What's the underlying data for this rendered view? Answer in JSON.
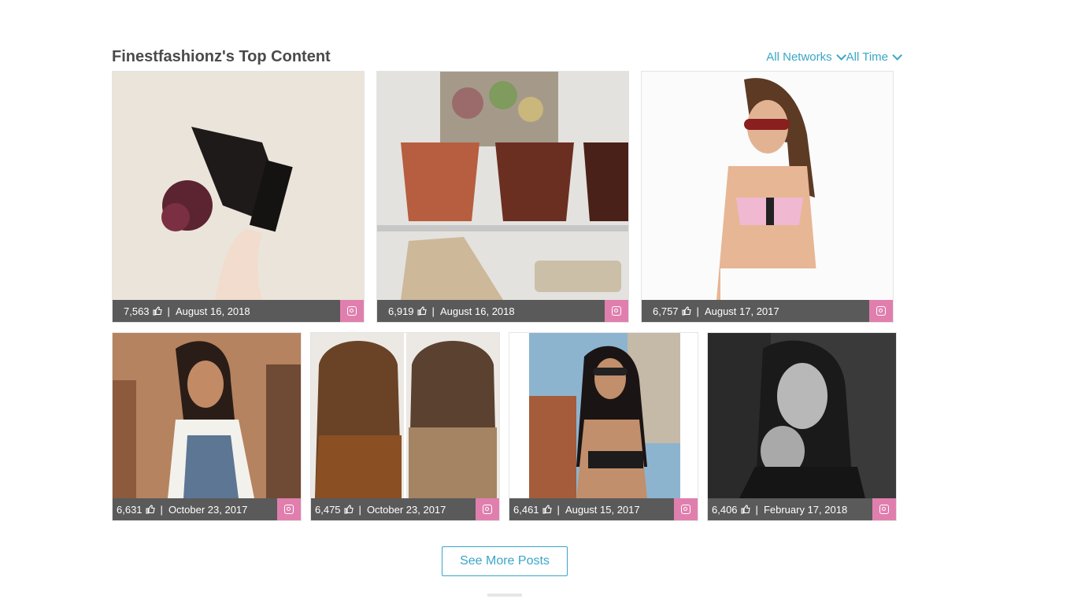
{
  "header": {
    "title": "Finestfashionz's Top Content",
    "filter_network": "All Networks",
    "filter_time": "All Time"
  },
  "posts": [
    {
      "likes": "7,563",
      "date": "August 16, 2018",
      "network_icon": "instagram-icon"
    },
    {
      "likes": "6,919",
      "date": "August 16, 2018",
      "network_icon": "instagram-icon"
    },
    {
      "likes": "6,757",
      "date": "August 17, 2017",
      "network_icon": "instagram-icon"
    },
    {
      "likes": "6,631",
      "date": "October 23, 2017",
      "network_icon": "instagram-icon"
    },
    {
      "likes": "6,475",
      "date": "October 23, 2017",
      "network_icon": "instagram-icon"
    },
    {
      "likes": "6,461",
      "date": "August 15, 2017",
      "network_icon": "instagram-icon"
    },
    {
      "likes": "6,406",
      "date": "February 17, 2018",
      "network_icon": "instagram-icon"
    }
  ],
  "footer": {
    "see_more_label": "See More Posts"
  },
  "colors": {
    "accent": "#3aa6c7",
    "bar": "#5a5a5a",
    "instagram": "#e07fae",
    "title": "#4a4a4a"
  }
}
